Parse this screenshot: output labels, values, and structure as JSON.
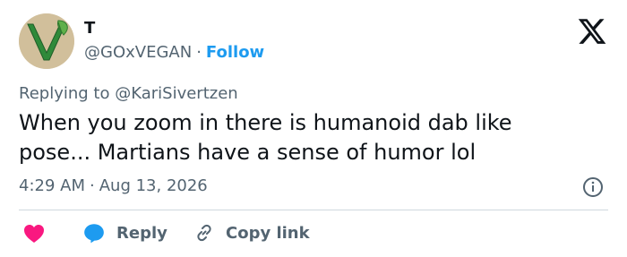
{
  "author": {
    "display_name": "T",
    "handle": "@GOxVEGAN",
    "separator": "·",
    "follow_label": "Follow"
  },
  "reply_context": {
    "prefix": "Replying to",
    "mention": "@KariSivertzen"
  },
  "tweet": {
    "text": "When you zoom in there is humanoid dab like\npose... Martians have a sense of humor lol",
    "time": "4:29 AM",
    "separator": "·",
    "date": "Aug 13, 2026"
  },
  "actions": {
    "reply_label": "Reply",
    "copy_label": "Copy link"
  },
  "icons": {
    "brand_logo": "x-logo-icon",
    "info": "info-icon",
    "like": "heart-icon",
    "reply": "speech-bubble-icon",
    "copy": "link-icon"
  },
  "colors": {
    "link_blue": "#1d9bf0",
    "muted_text": "#536471",
    "body_text": "#0f1419",
    "heart_red": "#f91880",
    "divider": "#cfd9de",
    "avatar_bg": "#d9c9a8",
    "avatar_logo_green": "#2f8a3a"
  }
}
